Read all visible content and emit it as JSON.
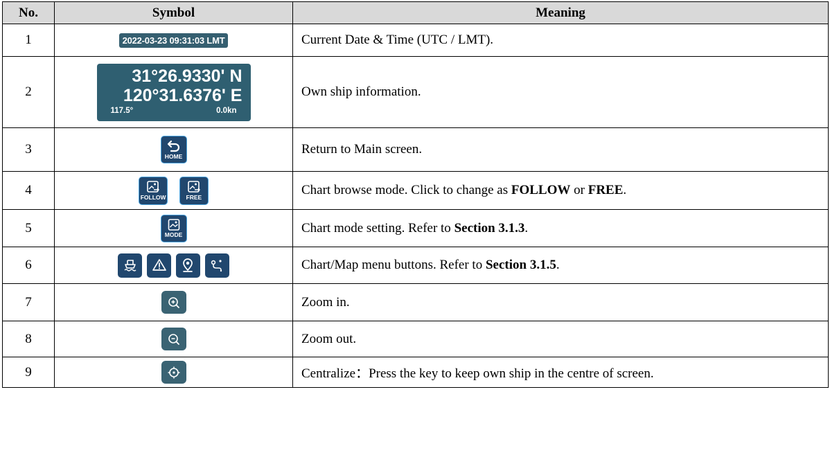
{
  "headers": {
    "no": "No.",
    "symbol": "Symbol",
    "meaning": "Meaning"
  },
  "rows": [
    {
      "no": "1",
      "meaning": "Current Date & Time (UTC / LMT)."
    },
    {
      "no": "2",
      "meaning": "Own ship information."
    },
    {
      "no": "3",
      "meaning": "Return to Main screen."
    },
    {
      "no": "4",
      "meaning_pre": "Chart browse mode. Click to change as ",
      "meaning_b1": "FOLLOW",
      "meaning_mid": " or ",
      "meaning_b2": "FREE",
      "meaning_post": "."
    },
    {
      "no": "5",
      "meaning_pre": "Chart mode setting. Refer to ",
      "meaning_b1": "Section 3.1.3",
      "meaning_post": "."
    },
    {
      "no": "6",
      "meaning_pre": "Chart/Map menu buttons. Refer to ",
      "meaning_b1": "Section 3.1.5",
      "meaning_post": "."
    },
    {
      "no": "7",
      "meaning": "Zoom in."
    },
    {
      "no": "8",
      "meaning": "Zoom out."
    },
    {
      "no": "9",
      "meaning": "Centralize：Press the key to keep own ship in the centre of screen."
    }
  ],
  "symbols": {
    "datetime": "2022-03-23 09:31:03 LMT",
    "lat": "31°26.9330' N",
    "lon": "120°31.6376' E",
    "heading": "117.5°",
    "speed": "0.0kn",
    "home_label": "HOME",
    "follow_label": "FOLLOW",
    "free_label": "FREE",
    "mode_label": "MODE",
    "menu_icons": [
      "ship-icon",
      "warning-icon",
      "map-pin-icon",
      "route-icon"
    ],
    "zoom_in_icon": "zoom-in-icon",
    "zoom_out_icon": "zoom-out-icon",
    "centralize_icon": "crosshair-icon"
  },
  "colors": {
    "header_bg": "#d9d9d9",
    "button_bg": "#21476e",
    "button_border": "#4aa3df",
    "panel_bg": "#2f5f71",
    "zoom_bg": "#3a6373"
  }
}
